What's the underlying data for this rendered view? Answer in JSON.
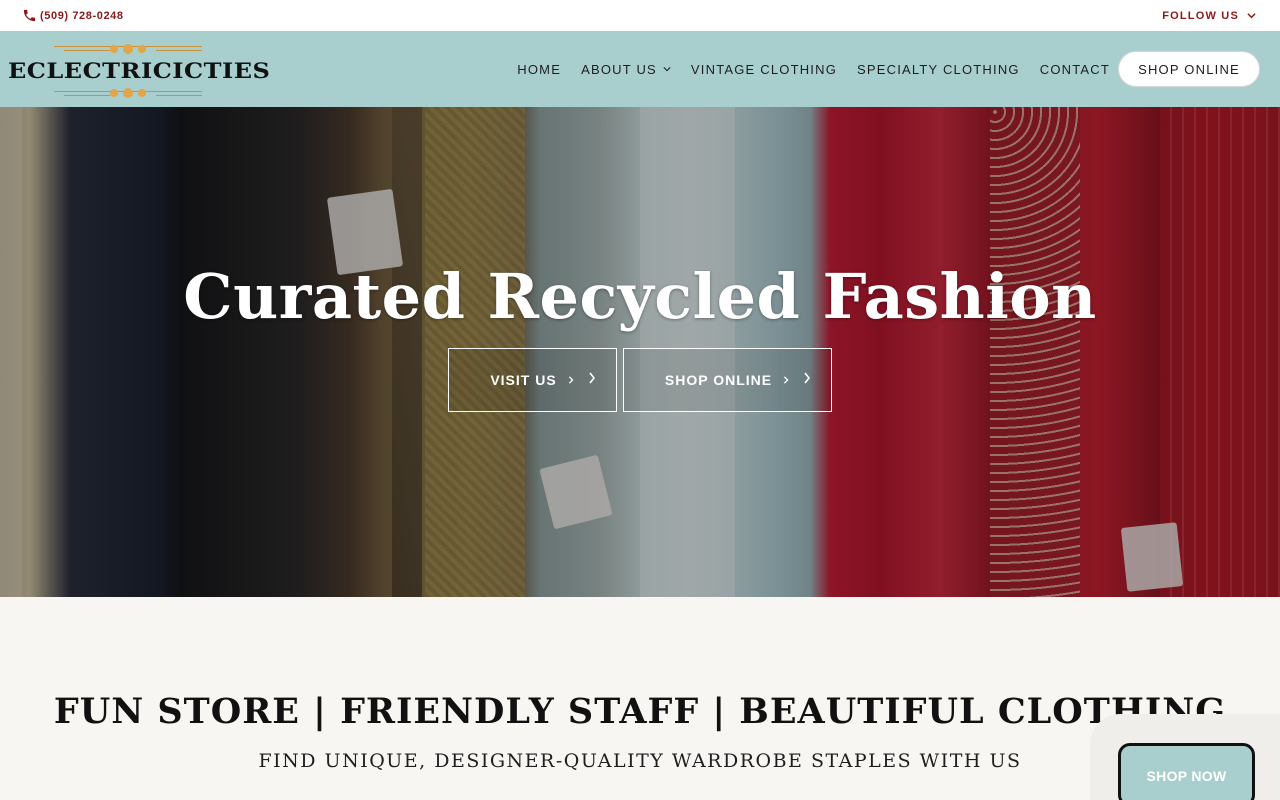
{
  "topbar": {
    "phone": "(509) 728-0248",
    "follow_label": "FOLLOW US"
  },
  "header": {
    "logo_text": "ECLECTRICICTIES",
    "nav": [
      {
        "label": "HOME"
      },
      {
        "label": "ABOUT US",
        "has_dropdown": true
      },
      {
        "label": "VINTAGE CLOTHING"
      },
      {
        "label": "SPECIALTY CLOTHING"
      },
      {
        "label": "CONTACT"
      }
    ],
    "shop_button": "SHOP ONLINE"
  },
  "hero": {
    "title": "Curated Recycled Fashion",
    "buttons": [
      {
        "label": "VISIT US"
      },
      {
        "label": "SHOP ONLINE"
      }
    ]
  },
  "intro": {
    "title": "FUN STORE | FRIENDLY STAFF | BEAUTIFUL CLOTHING",
    "subtitle": "FIND UNIQUE, DESIGNER-QUALITY WARDROBE STAPLES WITH US"
  },
  "floating": {
    "shop_now": "SHOP NOW"
  },
  "colors": {
    "header_bg": "#a8cfce",
    "accent_red": "#8a1a1a",
    "page_bg": "#f8f6f2",
    "logo_gold": "#e0a648"
  },
  "icons": {
    "phone": "phone-icon",
    "dropdown": "chevron-down-icon",
    "button_arrow": "chevron-right-icon"
  }
}
